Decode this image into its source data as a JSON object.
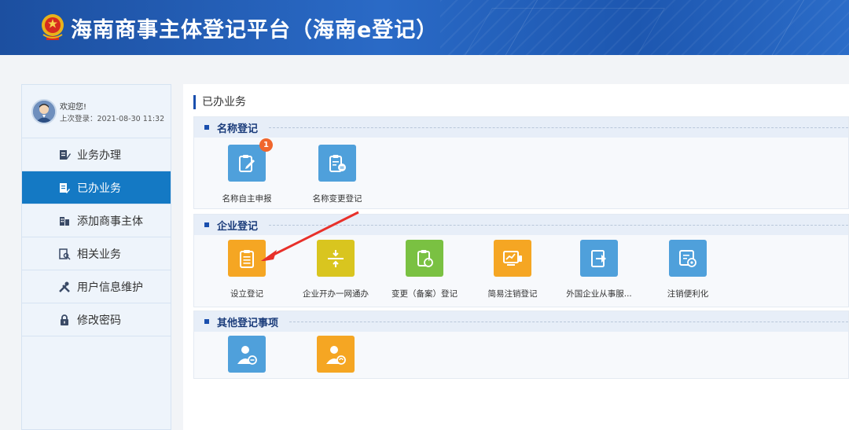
{
  "header": {
    "title": "海南商事主体登记平台（海南e登记）"
  },
  "user": {
    "welcome": "欢迎您!",
    "last_login": "上次登录：2021-08-30 11:32"
  },
  "sidebar": {
    "items": [
      {
        "label": "业务办理",
        "icon": "pen-doc-icon",
        "active": false
      },
      {
        "label": "已办业务",
        "icon": "doc-edit-icon",
        "active": true
      },
      {
        "label": "添加商事主体",
        "icon": "building-icon",
        "active": false
      },
      {
        "label": "相关业务",
        "icon": "search-doc-icon",
        "active": false
      },
      {
        "label": "用户信息维护",
        "icon": "tools-icon",
        "active": false
      },
      {
        "label": "修改密码",
        "icon": "lock-icon",
        "active": false
      }
    ]
  },
  "main": {
    "title": "已办业务",
    "sections": [
      {
        "title": "名称登记",
        "tiles": [
          {
            "label": "名称自主申报",
            "color": "#4fa0db",
            "badge": "1"
          },
          {
            "label": "名称变更登记",
            "color": "#4fa0db"
          }
        ]
      },
      {
        "title": "企业登记",
        "tiles": [
          {
            "label": "设立登记",
            "color": "#f5a623"
          },
          {
            "label": "企业开办一网通办",
            "color": "#d9c51f"
          },
          {
            "label": "变更（备案）登记",
            "color": "#7ac142"
          },
          {
            "label": "简易注销登记",
            "color": "#f5a623"
          },
          {
            "label": "外国企业从事服...",
            "color": "#4fa0db"
          },
          {
            "label": "注销便利化",
            "color": "#4fa0db"
          }
        ]
      },
      {
        "title": "其他登记事项",
        "tiles": [
          {
            "label": "",
            "color": "#4fa0db"
          },
          {
            "label": "",
            "color": "#f5a623"
          }
        ]
      }
    ]
  },
  "colors": {
    "header": "#2a6ac6",
    "active_nav": "#1479c4",
    "arrow": "#e8302a"
  }
}
